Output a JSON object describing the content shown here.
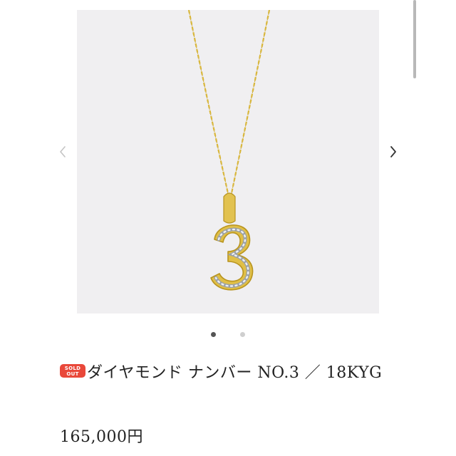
{
  "product": {
    "badge": {
      "line1": "SOLD",
      "line2": "OUT",
      "color": "#e9483a"
    },
    "name": "ダイヤモンド ナンバー NO.3 ／ 18KYG",
    "price": "165,000円"
  },
  "gallery": {
    "image_subject": "gold-number-3-diamond-pendant-necklace",
    "prev_icon": "chevron-left-icon",
    "next_icon": "chevron-right-icon",
    "slide_count": 2,
    "active_slide": 1
  },
  "colors": {
    "gold": "#d9b73c",
    "photo_background": "#f0eff1"
  }
}
